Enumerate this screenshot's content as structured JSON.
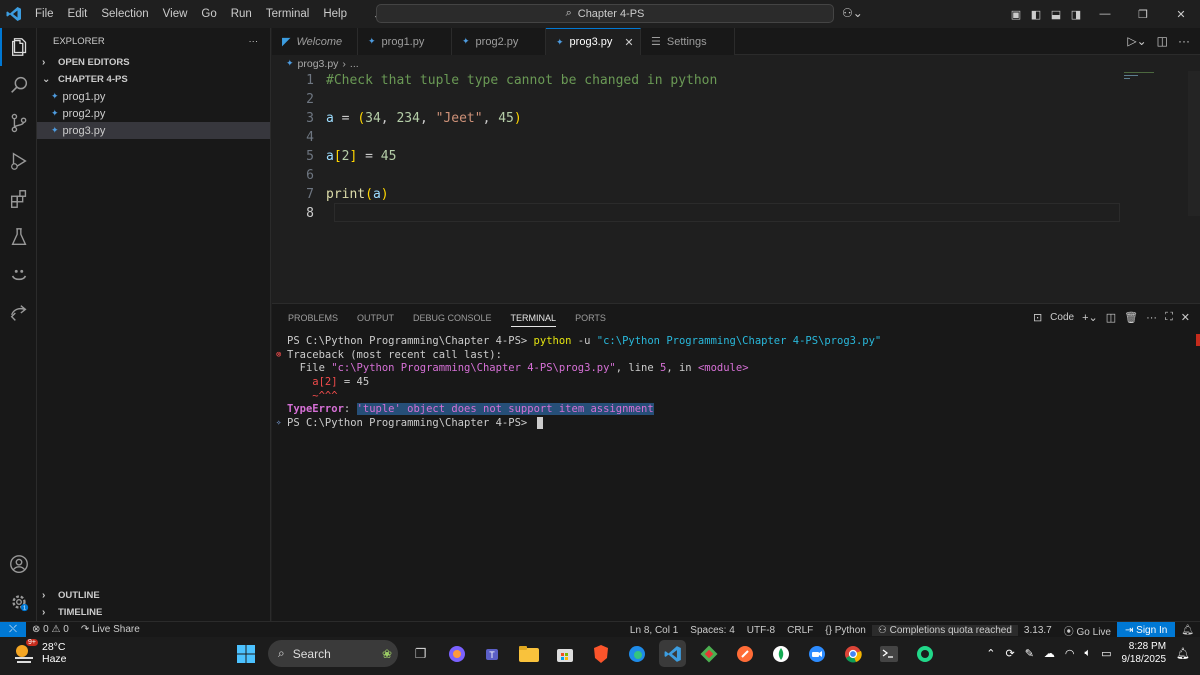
{
  "titlebar": {
    "menu": [
      "File",
      "Edit",
      "Selection",
      "View",
      "Go",
      "Run",
      "Terminal",
      "Help"
    ],
    "command_center": "Chapter 4-PS"
  },
  "sidebar": {
    "title": "EXPLORER",
    "more": "···",
    "open_editors": "OPEN EDITORS",
    "folder": "CHAPTER 4-PS",
    "files": [
      "prog1.py",
      "prog2.py",
      "prog3.py"
    ],
    "outline": "OUTLINE",
    "timeline": "TIMELINE"
  },
  "tabs": [
    {
      "label": "Welcome",
      "icon": "vscode-icon"
    },
    {
      "label": "prog1.py",
      "icon": "python-icon"
    },
    {
      "label": "prog2.py",
      "icon": "python-icon"
    },
    {
      "label": "prog3.py",
      "icon": "python-icon",
      "active": true
    },
    {
      "label": "Settings",
      "icon": "settings-icon"
    }
  ],
  "breadcrumb": {
    "file": "prog3.py",
    "rest": "..."
  },
  "editor": {
    "line_numbers": [
      "1",
      "2",
      "3",
      "4",
      "5",
      "6",
      "7",
      "8"
    ],
    "comment": "#Check that tuple type cannot be changed in python",
    "line3": {
      "var": "a",
      "op": " = ",
      "open": "(",
      "n1": "34",
      "n2": "234",
      "s": "\"Jeet\"",
      "n3": "45",
      "close": ")"
    },
    "line5": {
      "var": "a",
      "open": "[",
      "idx": "2",
      "close": "]",
      "op": " = ",
      "val": "45"
    },
    "line7": {
      "fn": "print",
      "open": "(",
      "arg": "a",
      "close": ")"
    }
  },
  "panel": {
    "tabs": [
      "PROBLEMS",
      "OUTPUT",
      "DEBUG CONSOLE",
      "TERMINAL",
      "PORTS"
    ],
    "active_tab": "TERMINAL",
    "shell_label": "Code",
    "terminal": {
      "prompt1": "PS C:\\Python Programming\\Chapter 4-PS> ",
      "cmd": "python",
      "flag": " -u ",
      "path": "\"c:\\Python Programming\\Chapter 4-PS\\prog3.py\"",
      "traceback": "Traceback (most recent call last):",
      "file_prefix": "  File ",
      "file_path": "\"c:\\Python Programming\\Chapter 4-PS\\prog3.py\"",
      "file_mid": ", line ",
      "line_no": "5",
      "file_in": ", in ",
      "module": "<module>",
      "code_a": "    a",
      "code_idx": "[2]",
      "code_rest": " = 45",
      "carets": "    ~^^^",
      "error_type": "TypeError",
      "error_colon": ": ",
      "error_msg": "'tuple' object does not support item assignment",
      "prompt2": "PS C:\\Python Programming\\Chapter 4-PS> "
    }
  },
  "statusbar": {
    "errors": "0",
    "warnings": "0",
    "live_share": "Live Share",
    "position": "Ln 8, Col 1",
    "spaces": "Spaces: 4",
    "encoding": "UTF-8",
    "eol": "CRLF",
    "language": "Python",
    "copilot": "Completions quota reached",
    "version": "3.13.7",
    "go_live": "Go Live",
    "sign_in": "Sign In"
  },
  "taskbar": {
    "temp": "28°C",
    "weather": "Haze",
    "search": "Search",
    "time": "8:28 PM",
    "date": "9/18/2025",
    "badge": "9+"
  },
  "colors": {
    "accent": "#0078d4",
    "background": "#1f1f1f",
    "comment": "#6a9955",
    "error": "#f14c4c"
  }
}
